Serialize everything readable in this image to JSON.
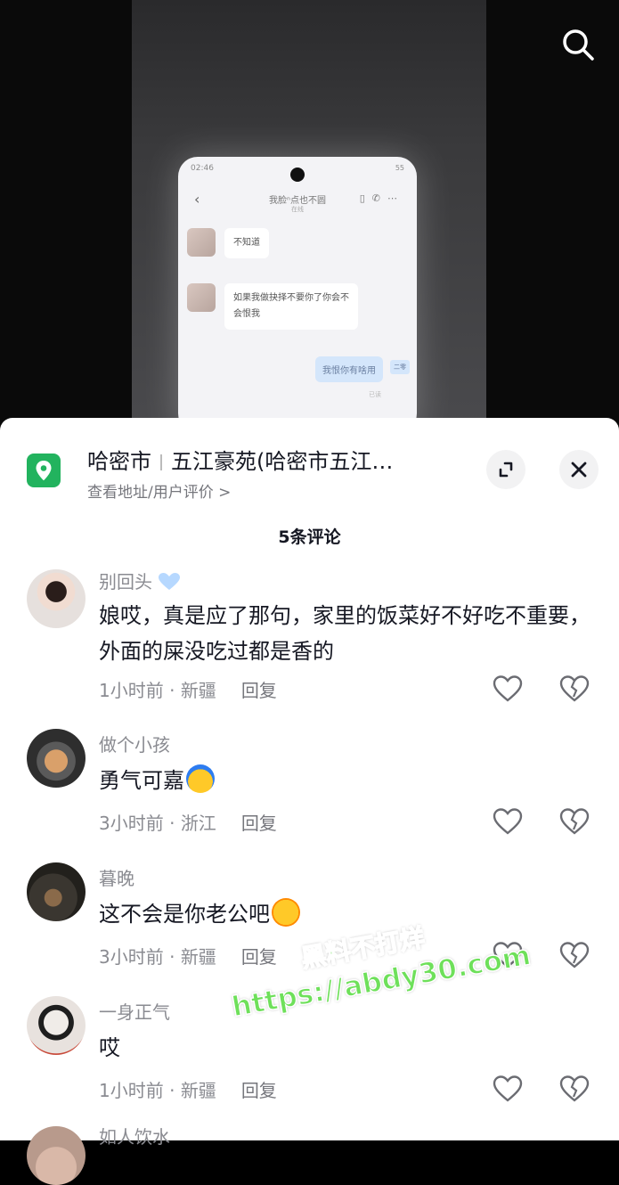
{
  "video": {
    "phone": {
      "status_time": "02:46",
      "battery": "55",
      "chat_title": "我脸ⁿ点也不圆",
      "chat_subtitle": "在线",
      "messages": [
        {
          "from": "other",
          "text": "不知道"
        },
        {
          "from": "other",
          "text_line1": "如果我做抉择不要你了你会不",
          "text_line2": "会恨我"
        },
        {
          "from": "me",
          "text": "我恨你有啥用",
          "tag": "二零",
          "time": "已读"
        }
      ]
    }
  },
  "sheet": {
    "location": {
      "city": "哈密市",
      "place": "五江豪苑(哈密市五江…",
      "link": "查看地址/用户评价 >"
    },
    "comment_count": "5条评论",
    "comments": [
      {
        "name": "别回头",
        "text": "娘哎，真是应了那句，家里的饭菜好不好吃不重要，外面的屎没吃过都是香的",
        "time": "1小时前",
        "region": "新疆",
        "reply": "回复"
      },
      {
        "name": "做个小孩",
        "text": "勇气可嘉",
        "time": "3小时前",
        "region": "浙江",
        "reply": "回复"
      },
      {
        "name": "暮晚",
        "text": "这不会是你老公吧",
        "time": "3小时前",
        "region": "新疆",
        "reply": "回复"
      },
      {
        "name": "一身正气",
        "text": "哎",
        "time": "1小时前",
        "region": "新疆",
        "reply": "回复"
      },
      {
        "name": "如人饮水"
      }
    ]
  },
  "watermark": {
    "line1": "黑料不打烊",
    "line2": "https://abdy30.com"
  },
  "colors": {
    "location_green": "#22b35e",
    "watermark_green": "#6ee05a",
    "text_primary": "#161823",
    "text_secondary": "#8a8b91"
  },
  "icons": [
    "search-icon",
    "location-pin-icon",
    "collapse-icon",
    "close-icon",
    "heart-icon",
    "broken-heart-icon",
    "verified-heart-badge-icon"
  ]
}
